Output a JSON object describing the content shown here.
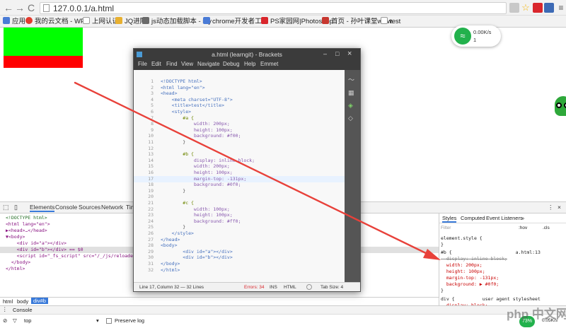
{
  "browser": {
    "url": "127.0.0.1/a.html",
    "bookmarks": [
      "应用",
      "我的云文档 - WPS",
      "上网认证",
      "JQ进阶",
      "js动态加载脚本 - my",
      "chrome开发者工具",
      "PS家园网|Photoshop",
      "首页 - 孙叶课堂www.",
      "test"
    ]
  },
  "speed_widget": {
    "upload": "0.00K/s",
    "count": "1"
  },
  "brackets": {
    "title": "a.html (learngit) - Brackets",
    "menu": [
      "File",
      "Edit",
      "Find",
      "View",
      "Navigate",
      "Debug",
      "Help",
      "Emmet"
    ],
    "lines": [
      {
        "n": "1",
        "t": "<!DOCTYPE html>"
      },
      {
        "n": "2",
        "t": "<html lang=\"en\">"
      },
      {
        "n": "3",
        "t": "<head>"
      },
      {
        "n": "4",
        "t": "    <meta charset=\"UTF-8\">"
      },
      {
        "n": "5",
        "t": "    <title>test</title>"
      },
      {
        "n": "6",
        "t": "    <style>"
      },
      {
        "n": "7",
        "t": "        #a {"
      },
      {
        "n": "8",
        "t": "            width: 200px;"
      },
      {
        "n": "9",
        "t": "            height: 100px;"
      },
      {
        "n": "10",
        "t": "            background: #f00;"
      },
      {
        "n": "11",
        "t": "        }"
      },
      {
        "n": "12",
        "t": ""
      },
      {
        "n": "13",
        "t": "        #b {"
      },
      {
        "n": "14",
        "t": "            display: inline-block;"
      },
      {
        "n": "15",
        "t": "            width: 200px;"
      },
      {
        "n": "16",
        "t": "            height: 100px;"
      },
      {
        "n": "17",
        "t": "            margin-top: -131px;"
      },
      {
        "n": "18",
        "t": "            background: #0f0;"
      },
      {
        "n": "19",
        "t": "        }"
      },
      {
        "n": "20",
        "t": ""
      },
      {
        "n": "21",
        "t": "        #c {"
      },
      {
        "n": "22",
        "t": "            width: 100px;"
      },
      {
        "n": "23",
        "t": "            height: 100px;"
      },
      {
        "n": "24",
        "t": "            background: #ff0;"
      },
      {
        "n": "25",
        "t": "        }"
      },
      {
        "n": "26",
        "t": "    </style>"
      },
      {
        "n": "27",
        "t": "</head>"
      },
      {
        "n": "28",
        "t": "<body>"
      },
      {
        "n": "29",
        "t": "        <div id=\"a\"></div>"
      },
      {
        "n": "30",
        "t": "        <div id=\"b\"></div>"
      },
      {
        "n": "31",
        "t": "</body>"
      },
      {
        "n": "32",
        "t": "</html>"
      }
    ],
    "status": {
      "position": "Line 17, Column 32 — 32 Lines",
      "errors": "Errors: 34",
      "ins": "INS",
      "lang": "HTML",
      "tab": "Tab Size: 4"
    }
  },
  "devtools": {
    "tabs": [
      "Elements",
      "Console",
      "Sources",
      "Network",
      "Tim"
    ],
    "dom": [
      "<!DOCTYPE html>",
      "<html lang=\"en\">",
      "▶<head>…</head>",
      "▼<body>",
      "    <div id=\"a\"></div>",
      "    <div id=\"b\"></div> == $0",
      "    <script id=\"_fs_script\" src=\"/_/js/reloader.j",
      "  </body>",
      "</html>"
    ],
    "style_tabs": [
      "Styles",
      "Computed",
      "Event Listeners",
      "»"
    ],
    "filter_placeholder": "Filter",
    "hov": ":hov",
    "cls": ".cls",
    "styles": [
      "element.style {",
      "}",
      "#b {                       a.html:13",
      "  display: inline-block;",
      "  width: 200px;",
      "  height: 100px;",
      "  margin-top: -131px;",
      "  background: ▶ #0f0;",
      "}",
      "div {          user agent stylesheet",
      "  display: block;"
    ],
    "breadcrumb": [
      "html",
      "body",
      "div#b"
    ],
    "console_label": "Console",
    "console_context": "top",
    "preserve_log": "Preserve log",
    "battery": "73%",
    "bottom_speed": "0.05K/s"
  },
  "watermark": "php 中文网"
}
